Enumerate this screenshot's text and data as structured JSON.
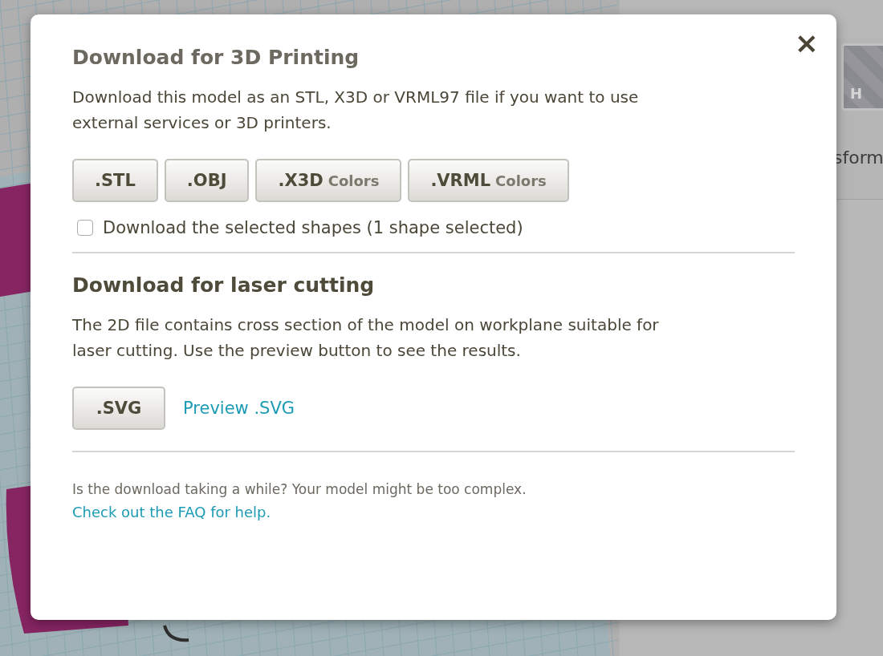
{
  "background": {
    "inspector_swatch_label": "H",
    "inspector_text": "sform"
  },
  "dialog": {
    "close": "×",
    "print_section": {
      "title": "Download for 3D Printing",
      "description": "Download this model as an STL, X3D or VRML97 file if you want to use external services or 3D printers.",
      "buttons": [
        {
          "label": ".STL"
        },
        {
          "label": ".OBJ"
        },
        {
          "label": ".X3D",
          "sub": "Colors"
        },
        {
          "label": ".VRML",
          "sub": "Colors"
        }
      ],
      "selected_only": {
        "label": "Download the selected shapes (1 shape selected)",
        "checked": false
      }
    },
    "laser_section": {
      "title": "Download for laser cutting",
      "description": "The 2D file contains cross section of the model on workplane suitable for laser cutting. Use the preview button to see the results.",
      "buttons": [
        {
          "label": ".SVG"
        }
      ],
      "preview_link": "Preview .SVG"
    },
    "footer": {
      "note": "Is the download taking a while? Your model might be too complex.",
      "help_link": "Check out the FAQ for help."
    }
  }
}
